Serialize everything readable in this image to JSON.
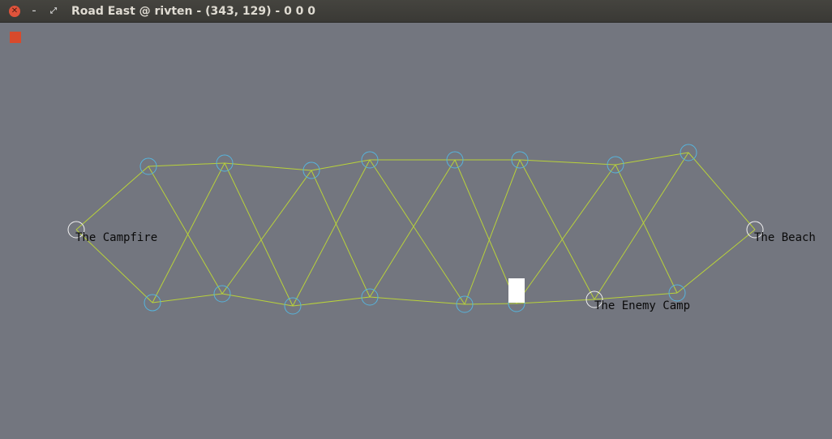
{
  "window": {
    "title": "Road East @ rivten - (343, 129) - 0 0 0",
    "controls": [
      "close-icon",
      "minimize-icon",
      "restore-icon"
    ]
  },
  "colors": {
    "canvas_bg": "#73767f",
    "edge": "#b9d23a",
    "node": "#56b4dc",
    "landmark_node": "#f2f2f2",
    "indicator": "#d84a2c",
    "player": "#ffffff"
  },
  "places": {
    "campfire": "The Campfire",
    "enemy_camp": "The Enemy Camp",
    "beach": "The Beach"
  }
}
